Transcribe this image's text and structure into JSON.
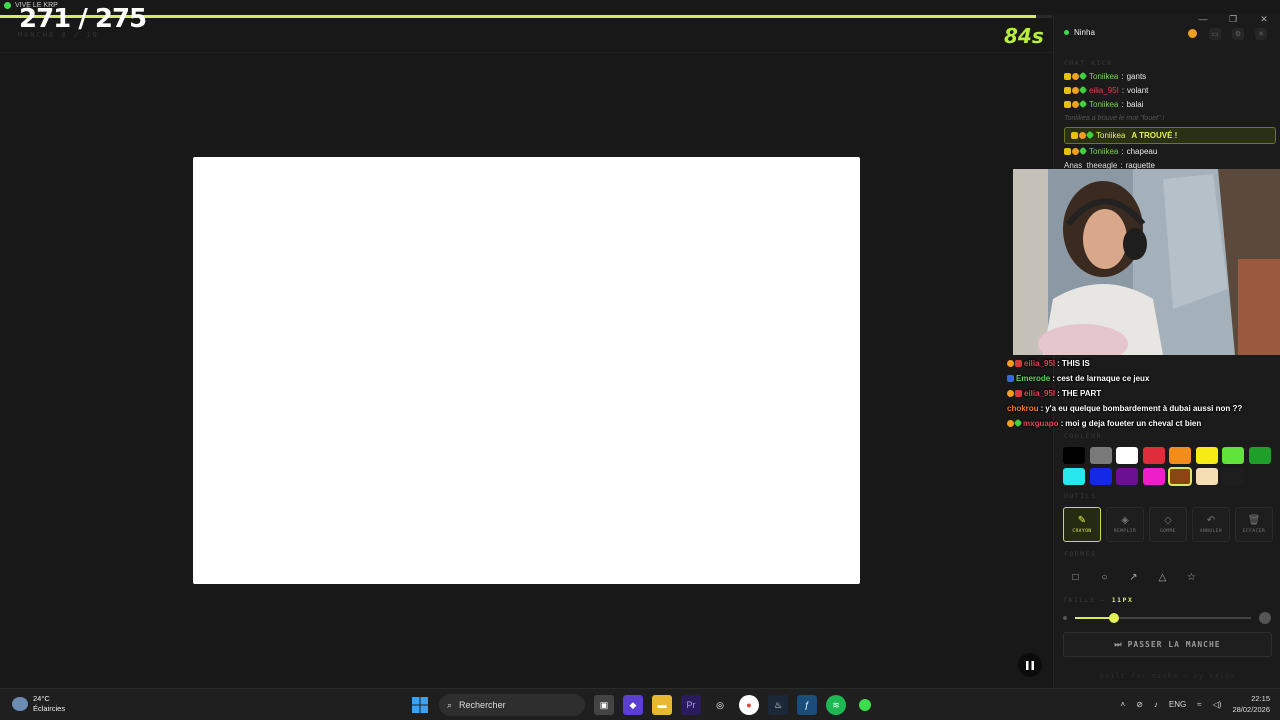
{
  "window": {
    "title": "VIVE LE KRP"
  },
  "game": {
    "score": "271 / 275",
    "round_label": "MANCHE 8 / 10",
    "timer": "84s",
    "progress_fraction": 0.985
  },
  "sidebar": {
    "streamer_name": "Ninha",
    "chat_label": "CHAT KICK",
    "chat": [
      {
        "user": "Toniikea",
        "sep": ":",
        "text": "gants",
        "color": "#7bd35a",
        "badges": [
          "crown",
          "one",
          "green"
        ]
      },
      {
        "user": "eilia_95I",
        "sep": ":",
        "text": "volant",
        "color": "#d6424a",
        "badges": [
          "crown",
          "one",
          "green"
        ]
      },
      {
        "user": "Toniikea",
        "sep": ":",
        "text": "balai",
        "color": "#7bd35a",
        "badges": [
          "crown",
          "one",
          "green"
        ]
      },
      {
        "system": "Toniikea a trouvé le mot \"fouet\" !"
      },
      {
        "user": "Toniikea",
        "sep": "",
        "text": "A TROUVÉ !",
        "color": "#e5f255",
        "badges": [
          "crown",
          "one",
          "green"
        ],
        "found": true
      },
      {
        "user": "Toniikea",
        "sep": ":",
        "text": "chapeau",
        "color": "#7bd35a",
        "badges": [
          "crown",
          "one",
          "green"
        ]
      },
      {
        "user": "Anas_theeagle",
        "sep": ":",
        "text": "raquette",
        "color": "#d9d9d9",
        "badges": []
      }
    ],
    "overlay_chat": [
      {
        "user": "eilia_95I",
        "text": "THIS IS",
        "color": "#e0455a",
        "badges": [
          "one",
          "red"
        ]
      },
      {
        "user": "Emerode",
        "text": "cest de larnaque ce jeux",
        "color": "#5ad75a",
        "badges": [
          "blue"
        ]
      },
      {
        "user": "eilia_95I",
        "text": "THE PART",
        "color": "#e0455a",
        "badges": [
          "one",
          "red"
        ]
      },
      {
        "user": "chokrou",
        "text": "y'a eu quelque bombardement à dubai aussi non ??",
        "color": "#f07a2c",
        "badges": []
      },
      {
        "user": "mxguapo",
        "text": "moi g deja foueter un cheval ct bien",
        "color": "#e0455a",
        "badges": [
          "one",
          "green"
        ]
      }
    ],
    "color_label": "COULEUR",
    "colors": [
      "#000000",
      "#7a7a7a",
      "#ffffff",
      "#e02d3c",
      "#f28c1a",
      "#f5ea14",
      "#5fe23a",
      "#1f9e2a",
      "#27e8ee",
      "#1428e8",
      "#6a1090",
      "#ee1ec8",
      "#8b4513",
      "#f5deb3",
      "#1e1e1e"
    ],
    "selected_color_index": 12,
    "tools_label": "OUTILS",
    "tools": [
      {
        "label": "CRAYON",
        "icon": "pencil-icon",
        "glyph": "✎"
      },
      {
        "label": "REMPLIR",
        "icon": "fill-icon",
        "glyph": "◈"
      },
      {
        "label": "GOMME",
        "icon": "eraser-icon",
        "glyph": "◇"
      },
      {
        "label": "ANNULER",
        "icon": "undo-icon",
        "glyph": "↶"
      },
      {
        "label": "EFFACER",
        "icon": "trash-icon",
        "glyph": "🗑"
      }
    ],
    "shapes_label": "FORMES",
    "shapes": [
      {
        "name": "rectangle",
        "glyph": "□"
      },
      {
        "name": "ellipse",
        "glyph": "○"
      },
      {
        "name": "arrow",
        "glyph": "↗"
      },
      {
        "name": "triangle",
        "glyph": "△"
      },
      {
        "name": "star",
        "glyph": "☆"
      }
    ],
    "size_label": "TAILLE —",
    "size_value": "11PX",
    "size_fraction": 0.22,
    "skip_button": "PASSER LA MANCHE",
    "footer": "built for ninha — by kaido"
  },
  "taskbar": {
    "weather_temp": "24°C",
    "weather_desc": "Éclaircies",
    "search_placeholder": "Rechercher",
    "lang": "ENG",
    "time": "22:15",
    "date": "28/02/2026"
  }
}
